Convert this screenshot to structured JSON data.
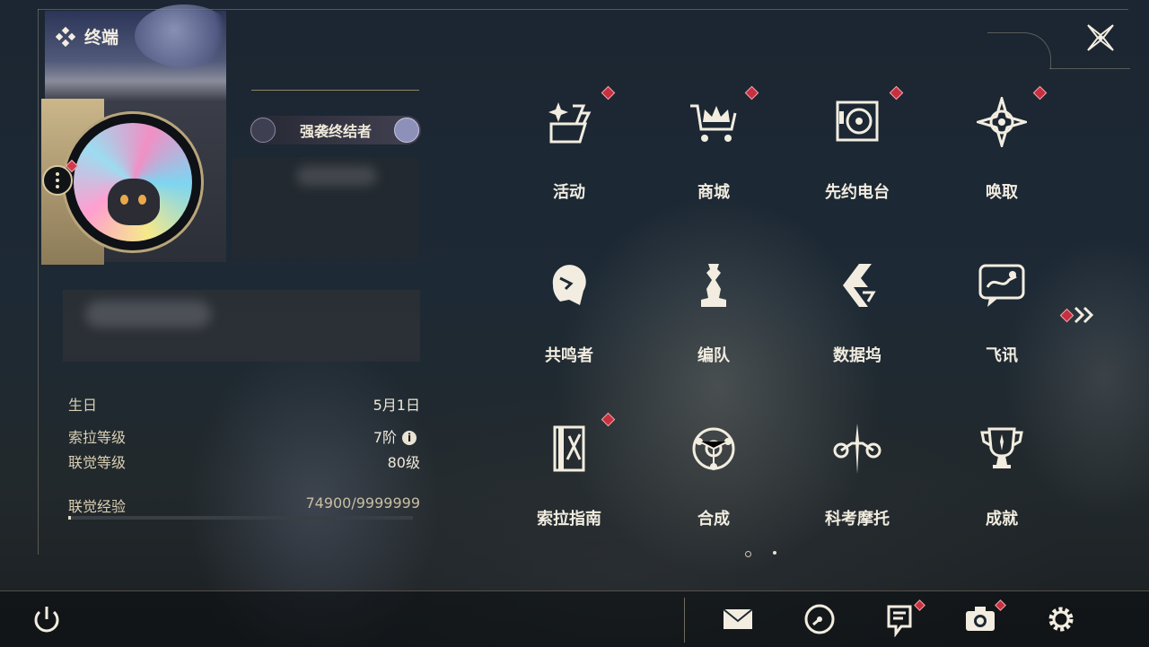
{
  "header": {
    "title": "终端",
    "title_icon": "diamond-cluster-icon",
    "close_icon": "close-icon"
  },
  "profile": {
    "title_badge": "强袭终结者",
    "more_icon": "more-vertical-icon",
    "info": [
      {
        "label": "生日",
        "value": "5月1日"
      },
      {
        "label": "索拉等级",
        "value": "7阶",
        "has_info_icon": true
      },
      {
        "label": "联觉等级",
        "value": "80级"
      }
    ],
    "experience": {
      "label": "联觉经验",
      "value": "74900/9999999",
      "progress_fraction": 0.0075
    }
  },
  "menu": [
    {
      "label": "活动",
      "icon": "sparkle-activity-icon",
      "notification": true
    },
    {
      "label": "商城",
      "icon": "shop-crown-cart-icon",
      "notification": true
    },
    {
      "label": "先约电台",
      "icon": "radio-speaker-icon",
      "notification": true
    },
    {
      "label": "唤取",
      "icon": "compass-star-icon",
      "notification": true
    },
    {
      "label": "共鸣者",
      "icon": "resonator-portrait-icon",
      "notification": false
    },
    {
      "label": "编队",
      "icon": "chess-piece-icon",
      "notification": false
    },
    {
      "label": "数据坞",
      "icon": "data-dock-icon",
      "notification": false
    },
    {
      "label": "飞讯",
      "icon": "chat-message-icon",
      "notification": false
    },
    {
      "label": "索拉指南",
      "icon": "guide-book-icon",
      "notification": true
    },
    {
      "label": "合成",
      "icon": "synthesis-orbit-icon",
      "notification": false
    },
    {
      "label": "科考摩托",
      "icon": "motorcycle-icon",
      "notification": false
    },
    {
      "label": "成就",
      "icon": "trophy-icon",
      "notification": false
    }
  ],
  "pager": {
    "pages": 2,
    "current": 1,
    "next_icon": "double-chevron-right-icon",
    "next_notification": true
  },
  "bottom_bar": {
    "power_icon": "power-icon",
    "buttons": [
      {
        "icon": "mail-icon",
        "notification": false
      },
      {
        "icon": "clock-icon",
        "notification": false
      },
      {
        "icon": "notice-icon",
        "notification": true
      },
      {
        "icon": "camera-icon",
        "notification": true
      },
      {
        "icon": "settings-gear-icon",
        "notification": false
      }
    ]
  },
  "colors": {
    "accent_gold": "#cbb68a",
    "notification_red": "#c7303f",
    "text": "#f1ece0"
  }
}
